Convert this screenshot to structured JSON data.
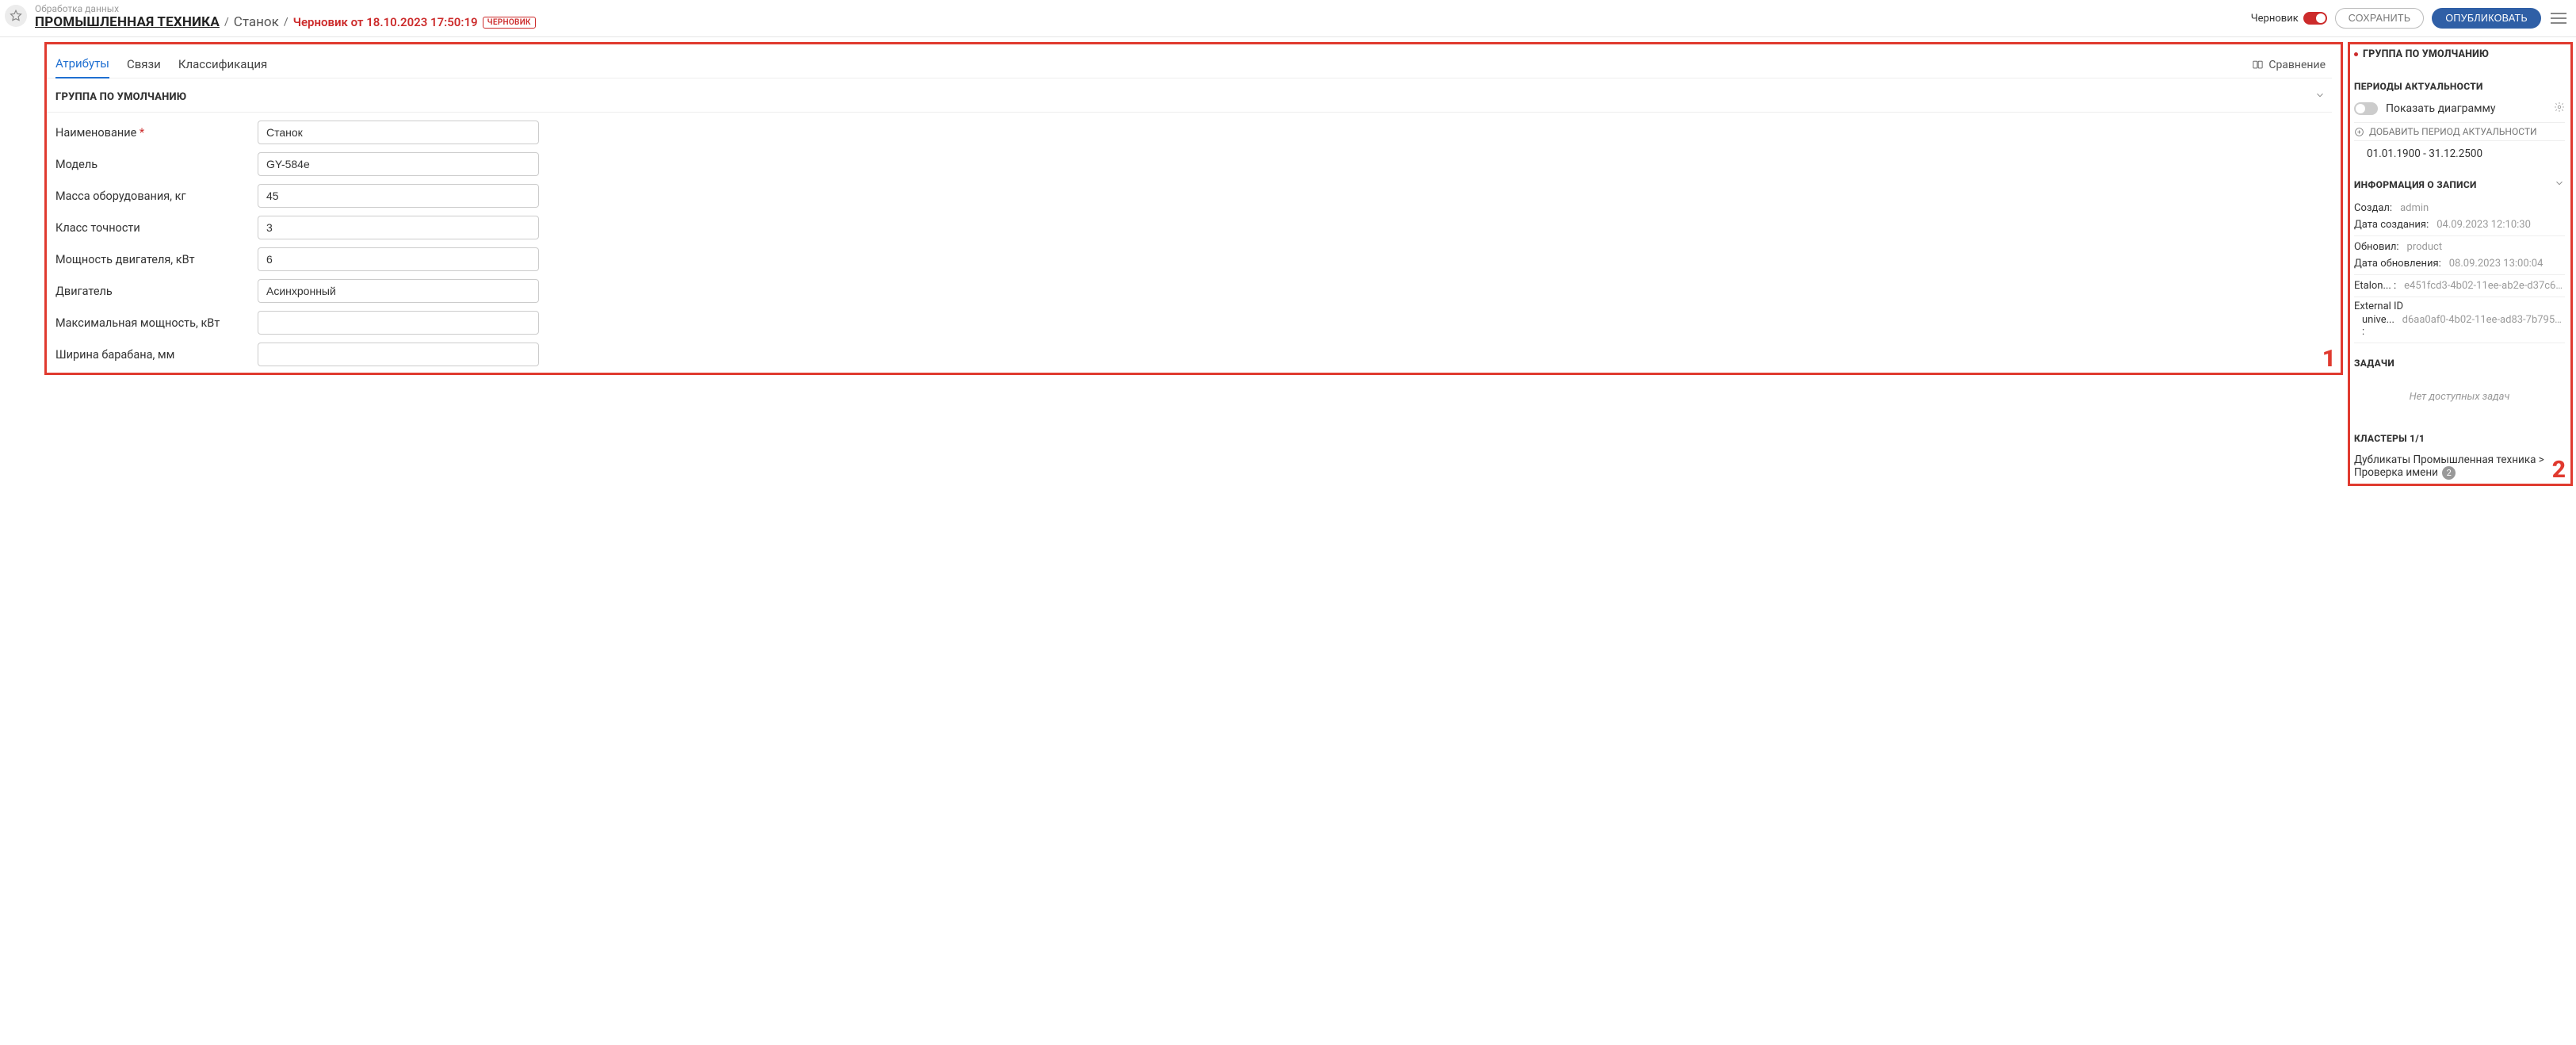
{
  "header": {
    "breadcrumb_top": "Обработка данных",
    "breadcrumb_link": "ПРОМЫШЛЕННАЯ ТЕХНИКА",
    "breadcrumb_sub": "Станок",
    "draft_info": "Черновик от 18.10.2023 17:50:19",
    "draft_badge": "ЧЕРНОВИК",
    "toggle_label": "Черновик",
    "btn_save": "СОХРАНИТЬ",
    "btn_publish": "ОПУБЛИКОВАТЬ"
  },
  "tabs": {
    "attributes": "Атрибуты",
    "links": "Связи",
    "classification": "Классификация",
    "compare": "Сравнение"
  },
  "group": {
    "title": "ГРУППА ПО УМОЛЧАНИЮ"
  },
  "fields": {
    "name_label": "Наименование",
    "name_value": "Станок",
    "model_label": "Модель",
    "model_value": "GY-584e",
    "mass_label": "Масса оборудования, кг",
    "mass_value": "45",
    "accuracy_label": "Класс точности",
    "accuracy_value": "3",
    "power_label": "Мощность двигателя, кВт",
    "power_value": "6",
    "engine_label": "Двигатель",
    "engine_value": "Асинхронный",
    "maxpower_label": "Максимальная мощность, кВт",
    "maxpower_value": "",
    "width_label": "Ширина барабана, мм",
    "width_value": ""
  },
  "side": {
    "group_title": "ГРУППА ПО УМОЛЧАНИЮ",
    "periods_title": "ПЕРИОДЫ АКТУАЛЬНОСТИ",
    "show_diagram": "Показать диаграмму",
    "add_period": "ДОБАВИТЬ ПЕРИОД АКТУАЛЬНОСТИ",
    "period_value": "01.01.1900 - 31.12.2500",
    "info_title": "ИНФОРМАЦИЯ О ЗАПИСИ",
    "created_k": "Создал:",
    "created_v": "admin",
    "created_date_k": "Дата создания:",
    "created_date_v": "04.09.2023 12:10:30",
    "updated_k": "Обновил:",
    "updated_v": "product",
    "updated_date_k": "Дата обновления:",
    "updated_date_v": "08.09.2023 13:00:04",
    "etalon_k": "Etalon... :",
    "etalon_v": "e451fcd3-4b02-11ee-ab2e-d37c61c...",
    "external_label": "External ID",
    "external_k": "unive... :",
    "external_v": "d6aa0af0-4b02-11ee-ad83-7b795d0...",
    "tasks_title": "ЗАДАЧИ",
    "no_tasks": "Нет доступных задач",
    "clusters_title": "КЛАСТЕРЫ 1/1",
    "cluster_line1": "Дубликаты Промышленная техника >",
    "cluster_line2": "Проверка имени",
    "cluster_count": "2"
  },
  "overlay": {
    "num1": "1",
    "num2": "2"
  }
}
